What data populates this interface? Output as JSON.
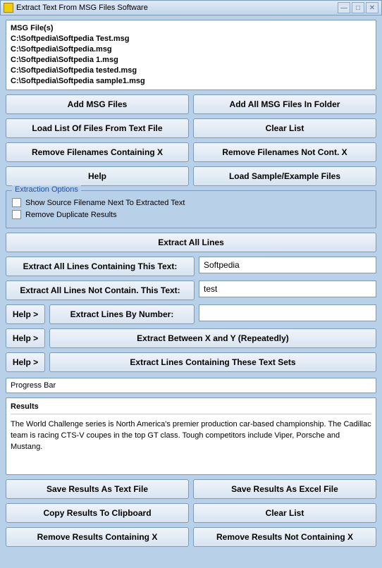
{
  "title": "Extract Text From MSG Files Software",
  "file_list": {
    "header": "MSG File(s)",
    "items": [
      "C:\\Softpedia\\Softpedia Test.msg",
      "C:\\Softpedia\\Softpedia.msg",
      "C:\\Softpedia\\Softpedia 1.msg",
      "C:\\Softpedia\\Softpedia tested.msg",
      "C:\\Softpedia\\Softpedia sample1.msg"
    ]
  },
  "buttons": {
    "add_msg": "Add MSG Files",
    "add_folder": "Add All MSG Files In Folder",
    "load_list": "Load List Of Files From Text File",
    "clear_list": "Clear List",
    "remove_containing": "Remove Filenames Containing X",
    "remove_not_containing": "Remove Filenames Not Cont. X",
    "help": "Help",
    "load_sample": "Load Sample/Example Files"
  },
  "options": {
    "legend": "Extraction Options",
    "show_source": "Show Source Filename Next To Extracted Text",
    "remove_dup": "Remove Duplicate Results"
  },
  "extract": {
    "all_lines": "Extract All Lines",
    "containing_label": "Extract All Lines Containing This Text:",
    "containing_value": "Softpedia",
    "not_containing_label": "Extract All Lines Not Contain. This Text:",
    "not_containing_value": "test",
    "help_btn": "Help >",
    "by_number": "Extract Lines By Number:",
    "between_xy": "Extract Between X and Y (Repeatedly)",
    "text_sets": "Extract Lines Containing These Text Sets"
  },
  "progress_label": "Progress Bar",
  "results": {
    "header": "Results",
    "text": "The World Challenge series is North America's premier production car-based championship.  The Cadillac team is racing CTS-V coupes in the top GT class.  Tough competitors include Viper, Porsche and Mustang."
  },
  "save": {
    "text_file": "Save Results As Text File",
    "excel_file": "Save Results As Excel File",
    "clipboard": "Copy Results To Clipboard",
    "clear": "Clear List",
    "remove_x": "Remove Results Containing X",
    "remove_not_x": "Remove Results Not Containing X"
  }
}
